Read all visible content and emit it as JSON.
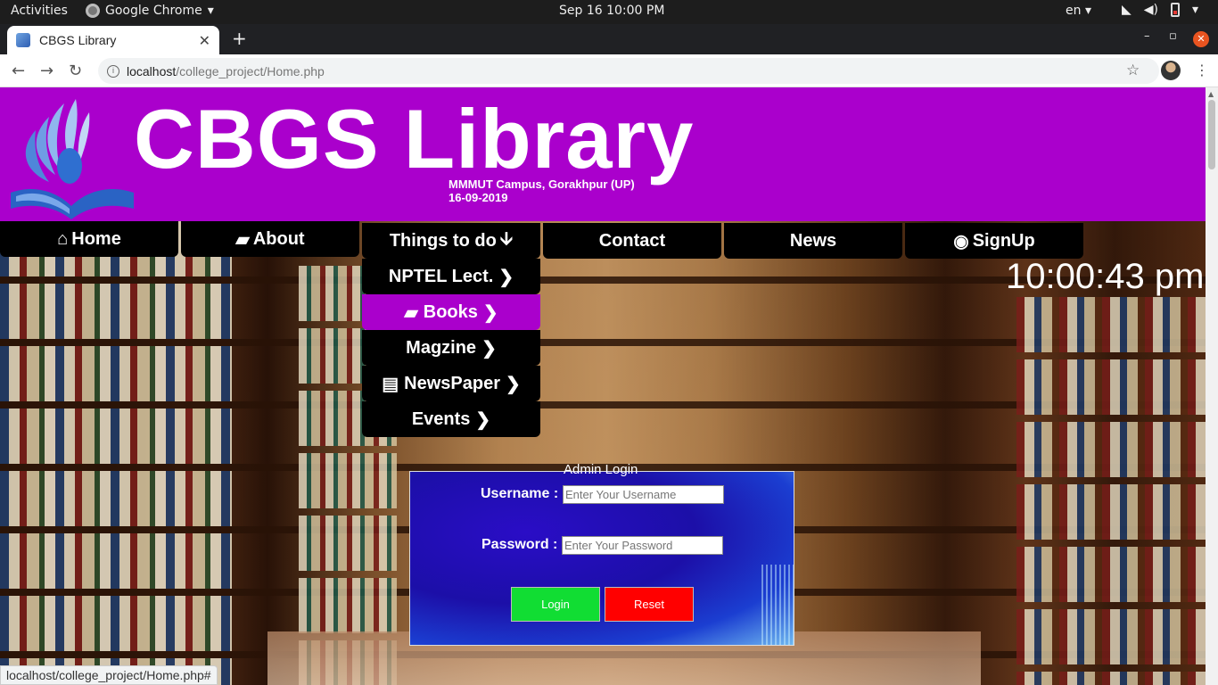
{
  "os_bar": {
    "activities": "Activities",
    "app_name": "Google Chrome",
    "clock": "Sep 16  10:00 PM",
    "language": "en"
  },
  "browser": {
    "tab_title": "CBGS Library",
    "url_host": "localhost",
    "url_path": "/college_project/Home.php",
    "status_url": "localhost/college_project/Home.php#"
  },
  "header": {
    "title": "CBGS Library",
    "campus": "MMMUT Campus, Gorakhpur (UP)",
    "date": "16-09-2019",
    "bg_color": "#aa00cc"
  },
  "nav": {
    "home": "Home",
    "about": "About",
    "things_to_do": "Things to do",
    "contact": "Contact",
    "news": "News",
    "signup": "SignUp"
  },
  "dropdown": {
    "nptel": "NPTEL Lect.",
    "books": "Books",
    "magzine": "Magzine",
    "newspaper": "NewsPaper",
    "events": "Events",
    "active": "books"
  },
  "clock_display": "10:00:43 pm",
  "login": {
    "legend": "Admin Login",
    "username_label": "Username :",
    "username_placeholder": "Enter Your Username",
    "password_label": "Password :",
    "password_placeholder": "Enter Your Password",
    "login_button": "Login",
    "reset_button": "Reset",
    "login_color": "#11dd33",
    "reset_color": "#ff0000"
  }
}
